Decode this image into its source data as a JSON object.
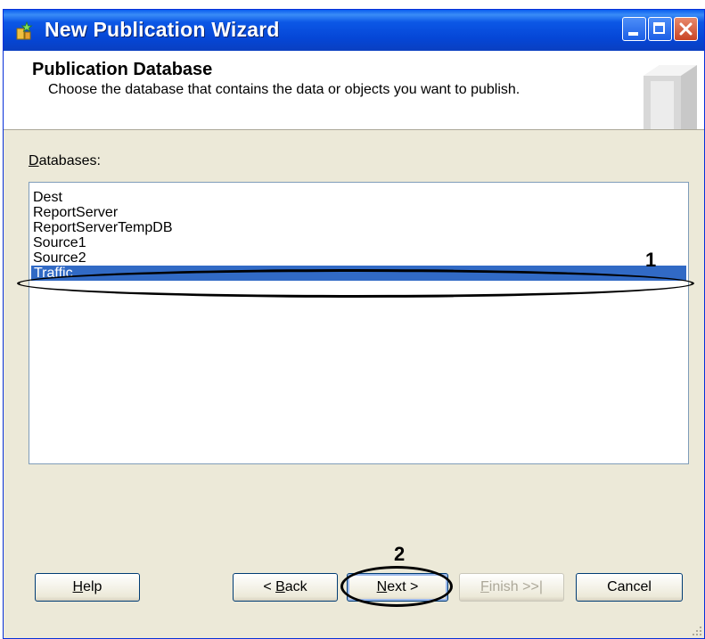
{
  "window": {
    "title": "New Publication Wizard"
  },
  "header": {
    "title": "Publication Database",
    "subtitle": "Choose the database that contains the data or objects you want to publish."
  },
  "databases": {
    "label_mnemonic": "D",
    "label_rest": "atabases:",
    "items": [
      "Dest",
      "ReportServer",
      "ReportServerTempDB",
      "Source1",
      "Source2",
      "Traffic"
    ],
    "selected": "Traffic"
  },
  "annotations": {
    "step1": "1",
    "step2": "2"
  },
  "buttons": {
    "help": {
      "mnemonic": "H",
      "rest": "elp"
    },
    "back": {
      "prefix": "< ",
      "mnemonic": "B",
      "rest": "ack"
    },
    "next": {
      "mnemonic": "N",
      "rest": "ext >"
    },
    "finish": {
      "mnemonic": "F",
      "rest": "inish >>|"
    },
    "cancel": "Cancel"
  },
  "colors": {
    "titlebar": "#0546d6",
    "selection": "#316ac5",
    "dialog_bg": "#ece9d8"
  }
}
